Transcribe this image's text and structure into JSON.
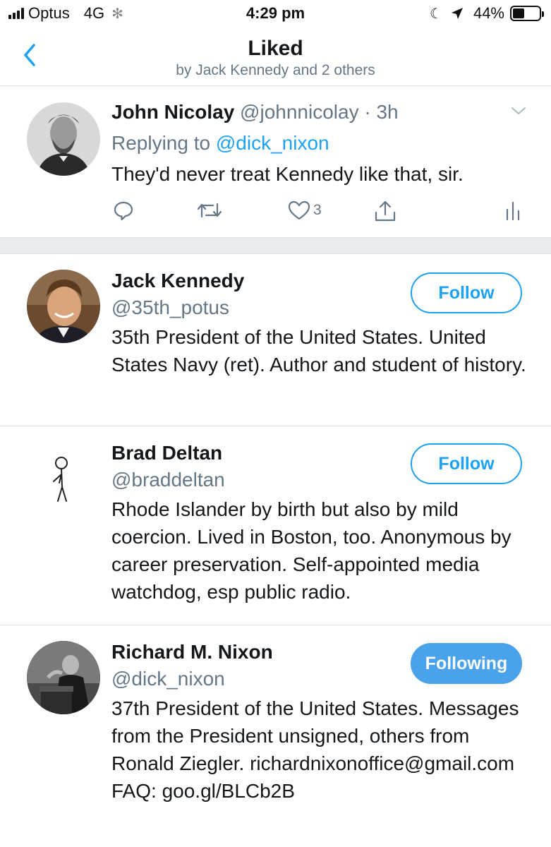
{
  "status_bar": {
    "carrier": "Optus",
    "network": "4G",
    "time": "4:29 pm",
    "battery_label": "44%",
    "battery_level": 0.44
  },
  "nav": {
    "title": "Liked",
    "subtitle": "by Jack Kennedy and 2 others",
    "back_icon": "chevron-left-icon"
  },
  "tweet": {
    "name": "John Nicolay",
    "handle": "@johnnicolay",
    "separator": " · ",
    "time": "3h",
    "replying_prefix": "Replying to ",
    "replying_to": "@dick_nixon",
    "text": "They'd never treat Kennedy like that, sir.",
    "like_count": "3",
    "icons": [
      "reply-icon",
      "retweet-icon",
      "like-icon",
      "share-icon",
      "analytics-icon"
    ]
  },
  "users": [
    {
      "name": "Jack Kennedy",
      "handle": "@35th_potus",
      "bio": "35th President of the United States. United States Navy (ret). Author and student of history.",
      "button": "Follow",
      "following": false
    },
    {
      "name": "Brad Deltan",
      "handle": "@braddeltan",
      "bio": "Rhode Islander by birth but also by mild coercion. Lived in Boston, too. Anonymous by career preservation. Self-appointed media watchdog, esp public radio.",
      "button": "Follow",
      "following": false
    },
    {
      "name": "Richard M. Nixon",
      "handle": "@dick_nixon",
      "bio": "37th President of the United States. Messages from the President unsigned, others from Ronald Ziegler. richardnixonoffice@gmail.com FAQ: goo.gl/BLCb2B",
      "button": "Following",
      "following": true
    }
  ],
  "colors": {
    "accent": "#1da1f2",
    "following_bg": "#4aa3ea",
    "secondary_text": "#657786",
    "divider": "#e6ecf0"
  }
}
